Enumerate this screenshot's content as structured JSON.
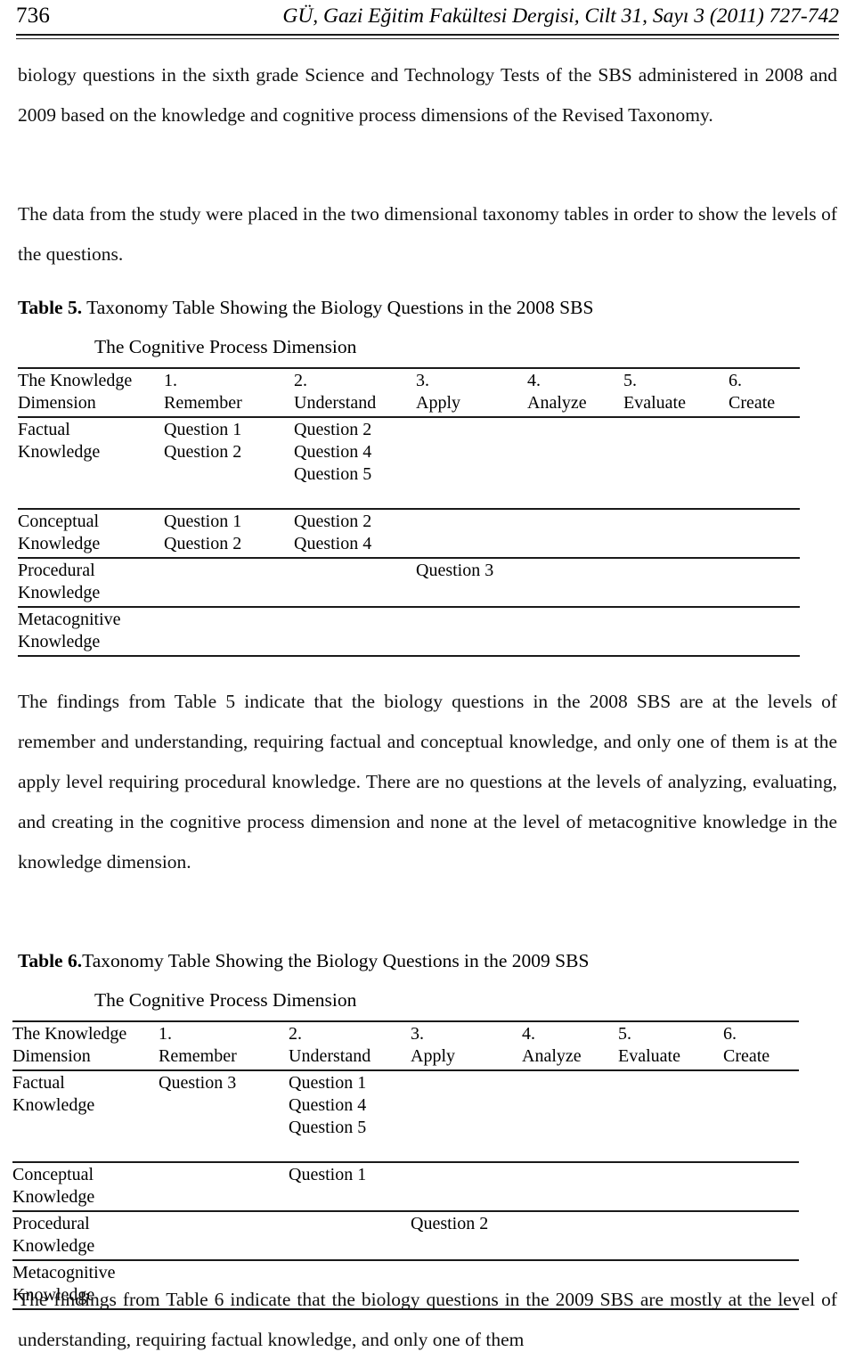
{
  "header": {
    "page_number": "736",
    "journal_line": "GÜ, Gazi Eğitim Fakültesi Dergisi, Cilt 31, Sayı 3 (2011) 727-742"
  },
  "body": {
    "paragraph_intro": "biology questions in the sixth grade Science and Technology Tests of the SBS administered in 2008 and 2009 based on the knowledge and cognitive process dimensions of the Revised Taxonomy.",
    "paragraph_data": "The data from the study were placed in the two dimensional taxonomy tables in order to show the levels of the questions.",
    "paragraph_findings_table5": "The findings from Table 5 indicate that the biology questions in the 2008 SBS are at the levels of remember and understanding, requiring factual and conceptual knowledge, and only one of them is at the apply level requiring procedural knowledge. There are no questions at the levels of analyzing, evaluating, and creating in the cognitive process dimension and none at the level of metacognitive knowledge in the knowledge dimension.",
    "paragraph_findings_table6": "The findings from Table 6 indicate that the biology questions in the 2009 SBS are mostly at the level of understanding, requiring factual knowledge, and only one of them"
  },
  "table5": {
    "caption_label": "Table 5.",
    "caption_text": " Taxonomy Table Showing the Biology Questions in the 2008 SBS",
    "subcaption": "The Cognitive Process Dimension",
    "corner_header_line1": "The Knowledge",
    "corner_header_line2": "Dimension",
    "columns": [
      {
        "number": "1.",
        "name": "Remember"
      },
      {
        "number": "2.",
        "name": "Understand"
      },
      {
        "number": "3.",
        "name": "Apply"
      },
      {
        "number": "4.",
        "name": "Analyze"
      },
      {
        "number": "5.",
        "name": "Evaluate"
      },
      {
        "number": "6.",
        "name": "Create"
      }
    ],
    "rows": [
      {
        "label_line1": "Factual",
        "label_line2": "Knowledge",
        "cells": [
          [
            "Question 1",
            "Question 2"
          ],
          [
            "Question 2",
            "Question 4",
            "Question 5"
          ],
          [],
          [],
          [],
          []
        ]
      },
      {
        "label_line1": "Conceptual",
        "label_line2": "Knowledge",
        "cells": [
          [
            "Question 1",
            "Question 2"
          ],
          [
            "Question 2",
            "Question 4"
          ],
          [],
          [],
          [],
          []
        ]
      },
      {
        "label_line1": "Procedural",
        "label_line2": "Knowledge",
        "cells": [
          [],
          [],
          [
            "Question 3"
          ],
          [],
          [],
          []
        ]
      },
      {
        "label_line1": "Metacognitive",
        "label_line2": "Knowledge",
        "cells": [
          [],
          [],
          [],
          [],
          [],
          []
        ]
      }
    ]
  },
  "table6": {
    "caption_label": "Table 6.",
    "caption_text": "Taxonomy Table Showing the Biology Questions in the 2009 SBS",
    "subcaption": "The Cognitive Process Dimension",
    "corner_header_line1": "The Knowledge",
    "corner_header_line2": "Dimension",
    "columns": [
      {
        "number": "1.",
        "name": "Remember"
      },
      {
        "number": "2.",
        "name": "Understand"
      },
      {
        "number": "3.",
        "name": "Apply"
      },
      {
        "number": "4.",
        "name": "Analyze"
      },
      {
        "number": "5.",
        "name": "Evaluate"
      },
      {
        "number": "6.",
        "name": "Create"
      }
    ],
    "rows": [
      {
        "label_line1": "Factual",
        "label_line2": "Knowledge",
        "cells": [
          [
            "Question 3"
          ],
          [
            "Question 1",
            "Question 4",
            "Question 5"
          ],
          [],
          [],
          [],
          []
        ]
      },
      {
        "label_line1": "Conceptual",
        "label_line2": "Knowledge",
        "cells": [
          [],
          [
            "Question 1"
          ],
          [],
          [],
          [],
          []
        ]
      },
      {
        "label_line1": "Procedural",
        "label_line2": "Knowledge",
        "cells": [
          [],
          [],
          [
            "Question 2"
          ],
          [],
          [],
          []
        ]
      },
      {
        "label_line1": "Metacognitive",
        "label_line2": "Knowledge",
        "cells": [
          [],
          [],
          [],
          [],
          [],
          []
        ]
      }
    ]
  }
}
